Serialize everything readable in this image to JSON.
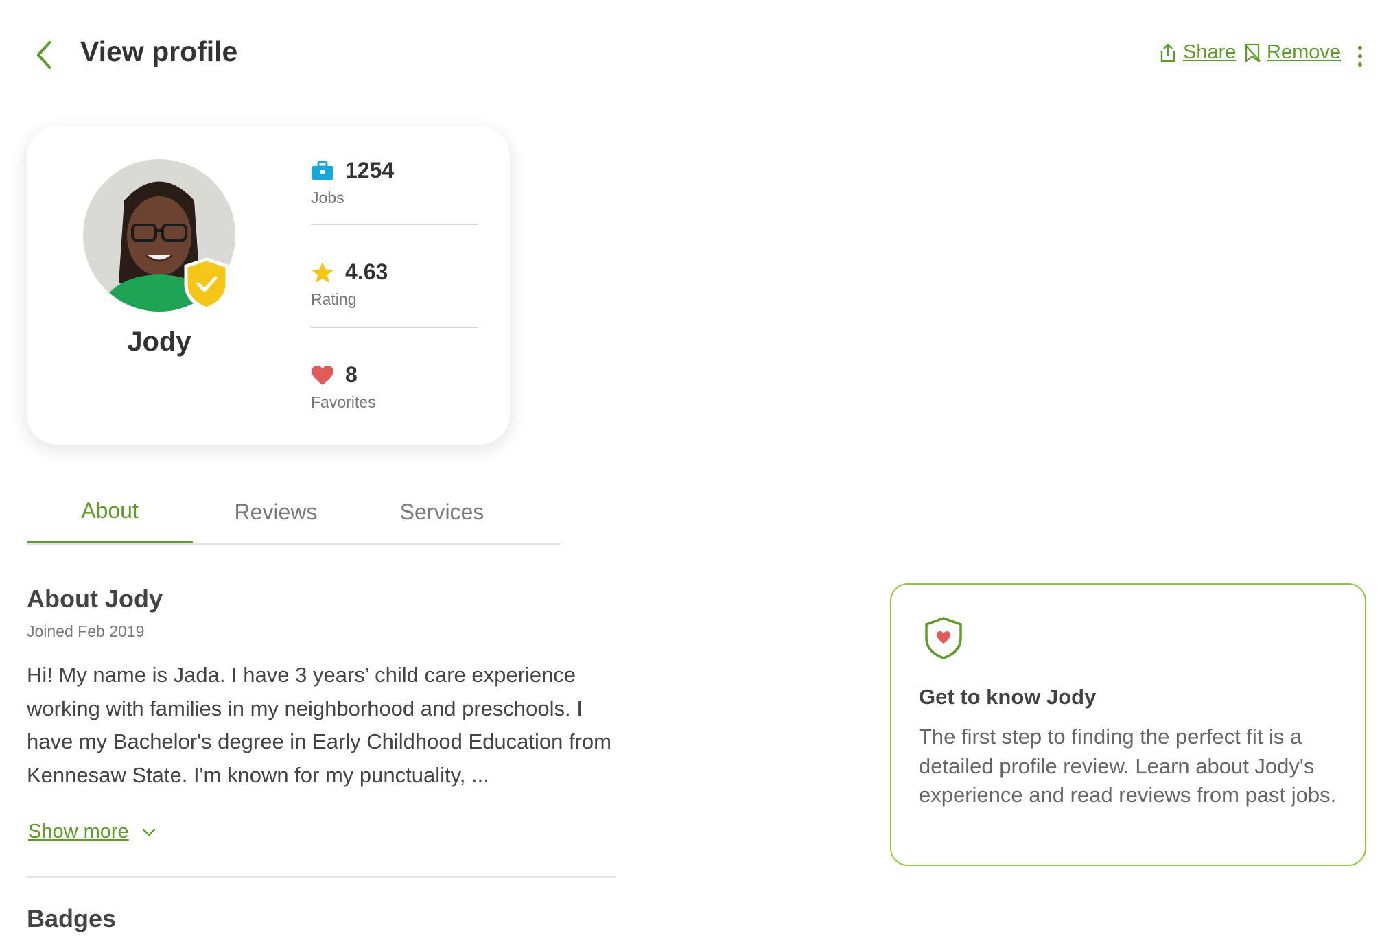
{
  "header": {
    "title": "View profile",
    "share_label": "Share",
    "remove_label": "Remove"
  },
  "profile": {
    "name": "Jody",
    "stats": [
      {
        "value": "1254",
        "label": "Jobs",
        "icon": "briefcase-icon"
      },
      {
        "value": "4.63",
        "label": "Rating",
        "icon": "star-icon"
      },
      {
        "value": "8",
        "label": "Favorites",
        "icon": "heart-icon"
      }
    ],
    "verified_badge_icon": "verified-shield-icon"
  },
  "tabs": [
    {
      "label": "About",
      "active": true
    },
    {
      "label": "Reviews",
      "active": false
    },
    {
      "label": "Services",
      "active": false
    }
  ],
  "about": {
    "title": "About Jody",
    "joined": "Joined Feb 2019",
    "bio": "Hi! My name is Jada. I have 3 years’ child care experience working with families in my neighborhood and preschools. I have my Bachelor's degree in Early Childhood Education from Kennesaw State. I'm known for my punctuality, ...",
    "show_more_label": "Show more"
  },
  "badges": {
    "title": "Badges"
  },
  "info_box": {
    "title": "Get to know Jody",
    "text": "The first step to finding the perfect fit is a detailed profile review. Learn about Jody's experience and read reviews from past jobs.",
    "icon": "shield-heart-icon"
  },
  "colors": {
    "accent": "#5f9b2b",
    "info_border": "#8cc63f",
    "briefcase": "#1aa7dc",
    "star": "#f5c518",
    "heart": "#e25b5b",
    "badge": "#f5c518"
  }
}
